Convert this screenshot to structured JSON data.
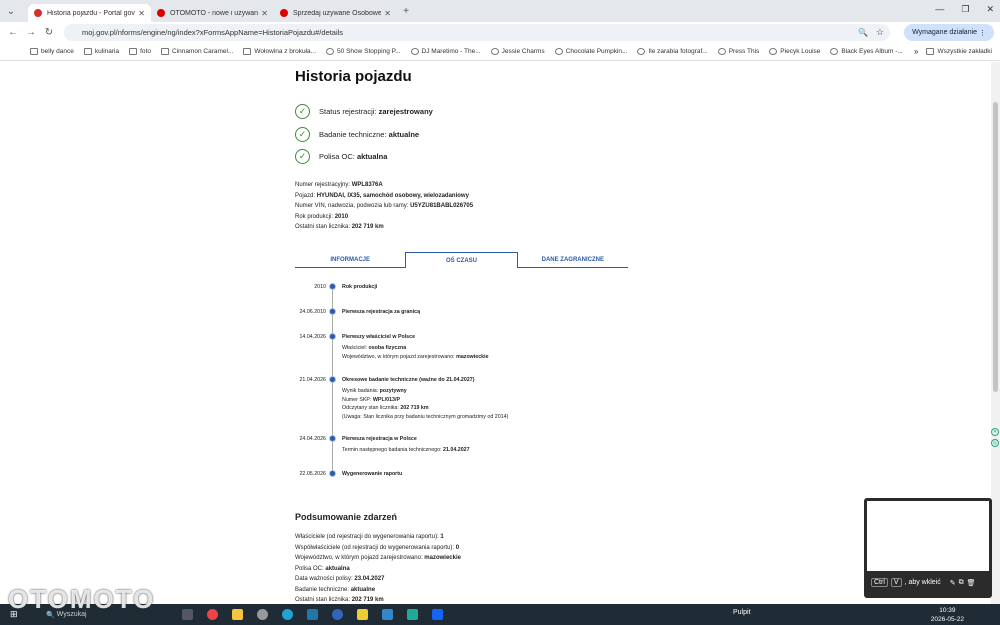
{
  "browser": {
    "tabs": [
      {
        "title": "Historia pojazdu - Portal gov.pl",
        "color": "#d32f2f"
      },
      {
        "title": "OTOMOTO - nowe i używane sa",
        "color": "#d00"
      },
      {
        "title": "Sprzedaj używane Osobowe | O",
        "color": "#d00"
      }
    ],
    "url": "moj.gov.pl/nforms/engine/ng/index?xFormsAppName=HistoriaPojazdu#/details",
    "required_action": "Wymagane działanie",
    "bookmarks": [
      "belly dance",
      "kulinaria",
      "foto",
      "Cinnamon Caramel...",
      "Wołowina z brokuła...",
      "50 Show Stopping P...",
      "DJ Maretimo - The...",
      "Jessie Charms",
      "Chocolate Pumpkin...",
      "Ile zarabia fotograf...",
      "Press This",
      "Piecyk Louise",
      "Black Eyes Album -..."
    ],
    "all_bookmarks": "Wszystkie zakładki"
  },
  "page": {
    "title": "Historia pojazdu",
    "statuses": [
      {
        "label": "Status rejestracji:",
        "value": "zarejestrowany"
      },
      {
        "label": "Badanie techniczne:",
        "value": "aktualne"
      },
      {
        "label": "Polisa OC:",
        "value": "aktualna"
      }
    ],
    "info": [
      {
        "label": "Numer rejestracyjny:",
        "value": "WPL8376A"
      },
      {
        "label": "Pojazd:",
        "value": "HYUNDAI, IX35, samochód osobowy, wielozadaniowy"
      },
      {
        "label": "Numer VIN, nadwozia, podwozia lub ramy:",
        "value": "U5YZU81BABL026705"
      },
      {
        "label": "Rok produkcji:",
        "value": "2010"
      },
      {
        "label": "Ostatni stan licznika:",
        "value": "202 719 km"
      }
    ],
    "content_tabs": [
      "INFORMACJE",
      "OŚ CZASU",
      "DANE ZAGRANICZNE"
    ],
    "timeline": [
      {
        "date": "2010",
        "title": "Rok produkcji",
        "details": []
      },
      {
        "date": "24.06.2010",
        "title": "Pierwsza rejestracja za granicą",
        "details": []
      },
      {
        "date": "14.04.2026",
        "title": "Pierwszy właściciel w Polsce",
        "details": [
          {
            "label": "Właściciel:",
            "value": "osoba fizyczna"
          },
          {
            "label": "Województwo, w którym pojazd zarejestrowano:",
            "value": "mazowieckie"
          }
        ]
      },
      {
        "date": "21.04.2026",
        "title": "Okresowe badanie techniczne (ważne do 21.04.2027)",
        "details": [
          {
            "label": "Wynik badania:",
            "value": "pozytywny"
          },
          {
            "label": "Numer SKP:",
            "value": "WPL/013/P"
          },
          {
            "label": "Odczytany stan licznika:",
            "value": "202 719 km"
          },
          {
            "label": "(Uwaga: Stan licznika przy badaniu technicznym gromadzimy od 2014)",
            "value": ""
          }
        ]
      },
      {
        "date": "24.04.2026",
        "title": "Pierwsza rejestracja w Polsce",
        "details": [
          {
            "label": "Termin następnego badania technicznego:",
            "value": "21.04.2027"
          }
        ]
      },
      {
        "date": "22.05.2026",
        "title": "Wygenerowanie raportu",
        "details": []
      }
    ],
    "summary_title": "Podsumowanie zdarzeń",
    "summary": [
      {
        "label": "Właściciele (od rejestracji do wygenerowania raportu):",
        "value": "1"
      },
      {
        "label": "Współwłaściciele (od rejestracji do wygenerowania raportu):",
        "value": "0"
      },
      {
        "label": "Województwo, w którym pojazd zarejestrowano:",
        "value": "mazowieckie"
      },
      {
        "label": "Polisa OC:",
        "value": "aktualna"
      },
      {
        "label": "Data ważności polisy:",
        "value": "23.04.2027"
      },
      {
        "label": "Badanie techniczne:",
        "value": "aktualne"
      },
      {
        "label": "Ostatni stan licznika:",
        "value": "202 719 km"
      }
    ]
  },
  "overlay": {
    "hint_key1": "Ctrl",
    "hint_key2": "V",
    "hint_text": ", aby wkleić"
  },
  "taskbar": {
    "search": "Wyszukaj",
    "desktop": "Pulpit",
    "time": "10:39",
    "date": "2026-05-22",
    "watermark": "OTOMOTO"
  },
  "colors": {
    "accent": "#2a5aa8",
    "check": "#3f8a3a"
  }
}
